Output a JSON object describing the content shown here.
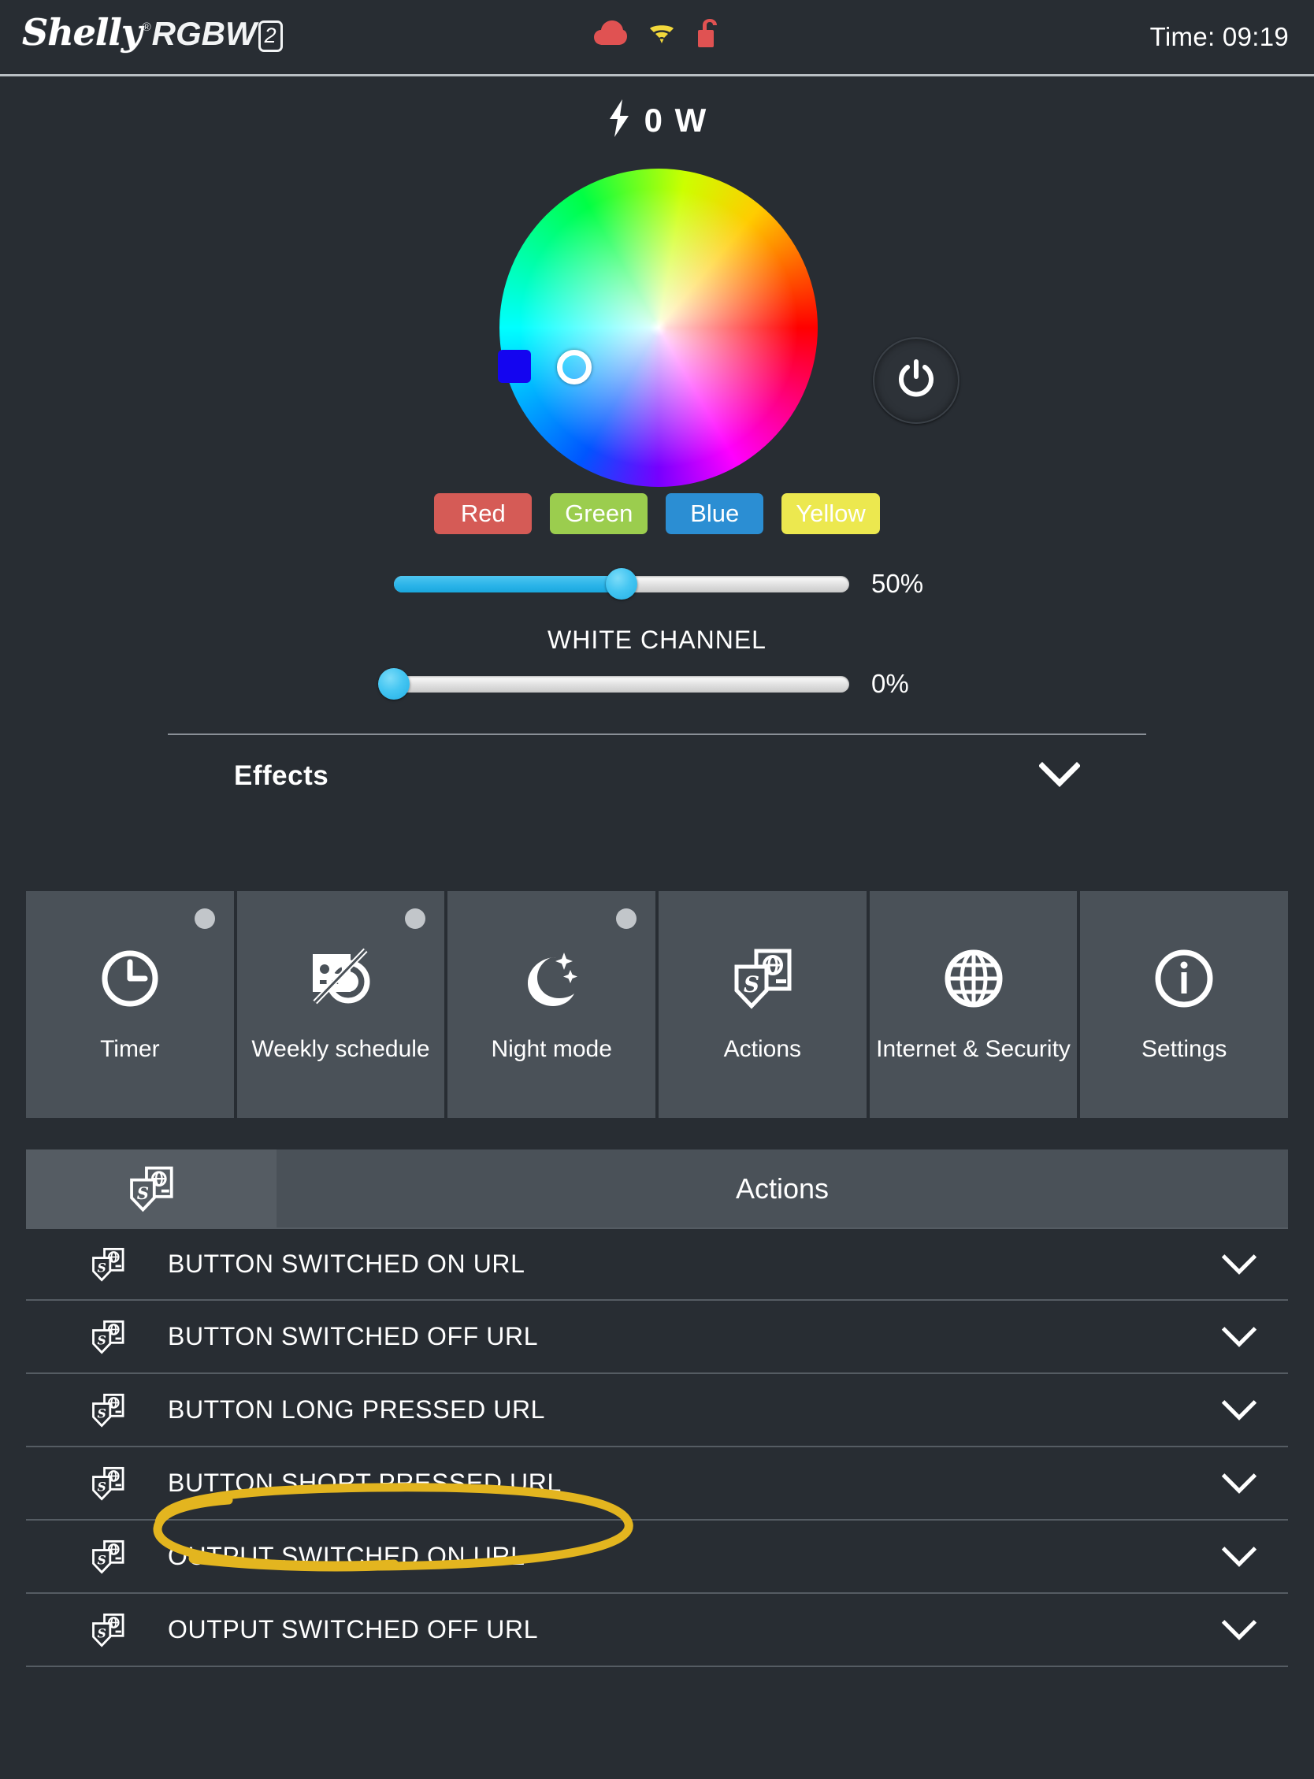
{
  "header": {
    "brand": "Shelly",
    "registered_mark": "®",
    "model": "RGBW",
    "model_suffix": "2",
    "icons": [
      {
        "name": "cloud-icon",
        "color": "#e05252"
      },
      {
        "name": "wifi-icon",
        "color": "#f2d83c"
      },
      {
        "name": "lock-open-icon",
        "color": "#e05252"
      }
    ],
    "time_label": "Time: 09:19"
  },
  "power": {
    "icon": "lightning-bolt-icon",
    "value": "0 W"
  },
  "color_picker": {
    "selected_swatch": "#1405f0",
    "cursor_position": "upper-left",
    "power_button_icon": "power-icon"
  },
  "presets": [
    {
      "label": "Red",
      "color": "#d55b56"
    },
    {
      "label": "Green",
      "color": "#9bcd4e"
    },
    {
      "label": "Blue",
      "color": "#2b8ed3"
    },
    {
      "label": "Yellow",
      "color": "#ece84f"
    }
  ],
  "brightness": {
    "value": "50%",
    "percent": 50
  },
  "white_channel": {
    "label": "WHITE CHANNEL",
    "value": "0%",
    "percent": 0
  },
  "effects": {
    "label": "Effects",
    "chevron": "chevron-down-icon"
  },
  "tiles": [
    {
      "label": "Timer",
      "icon": "clock-icon",
      "has_dot": true
    },
    {
      "label": "Weekly schedule",
      "icon": "calendar-disabled-icon",
      "has_dot": true
    },
    {
      "label": "Night mode",
      "icon": "moon-stars-icon",
      "has_dot": true
    },
    {
      "label": "Actions",
      "icon": "actions-icon",
      "has_dot": false
    },
    {
      "label": "Internet & Security",
      "icon": "globe-icon",
      "has_dot": false
    },
    {
      "label": "Settings",
      "icon": "info-circle-icon",
      "has_dot": false
    }
  ],
  "section": {
    "icon": "actions-icon",
    "title": "Actions"
  },
  "actions": [
    {
      "label": "BUTTON SWITCHED ON URL",
      "icon": "actions-icon",
      "highlighted": false
    },
    {
      "label": "BUTTON SWITCHED OFF URL",
      "icon": "actions-icon",
      "highlighted": false
    },
    {
      "label": "BUTTON LONG PRESSED URL",
      "icon": "actions-icon",
      "highlighted": true
    },
    {
      "label": "BUTTON SHORT PRESSED URL",
      "icon": "actions-icon",
      "highlighted": false
    },
    {
      "label": "OUTPUT SWITCHED ON URL",
      "icon": "actions-icon",
      "highlighted": false
    },
    {
      "label": "OUTPUT SWITCHED OFF URL",
      "icon": "actions-icon",
      "highlighted": false
    }
  ],
  "annotation": {
    "type": "hand-drawn-ellipse",
    "color": "#e3b51f",
    "target": "BUTTON LONG PRESSED URL"
  },
  "colors": {
    "background": "#282d33",
    "tile_background": "#4a5158",
    "accent_blue": "#29b3e8",
    "divider": "#8a9097"
  }
}
